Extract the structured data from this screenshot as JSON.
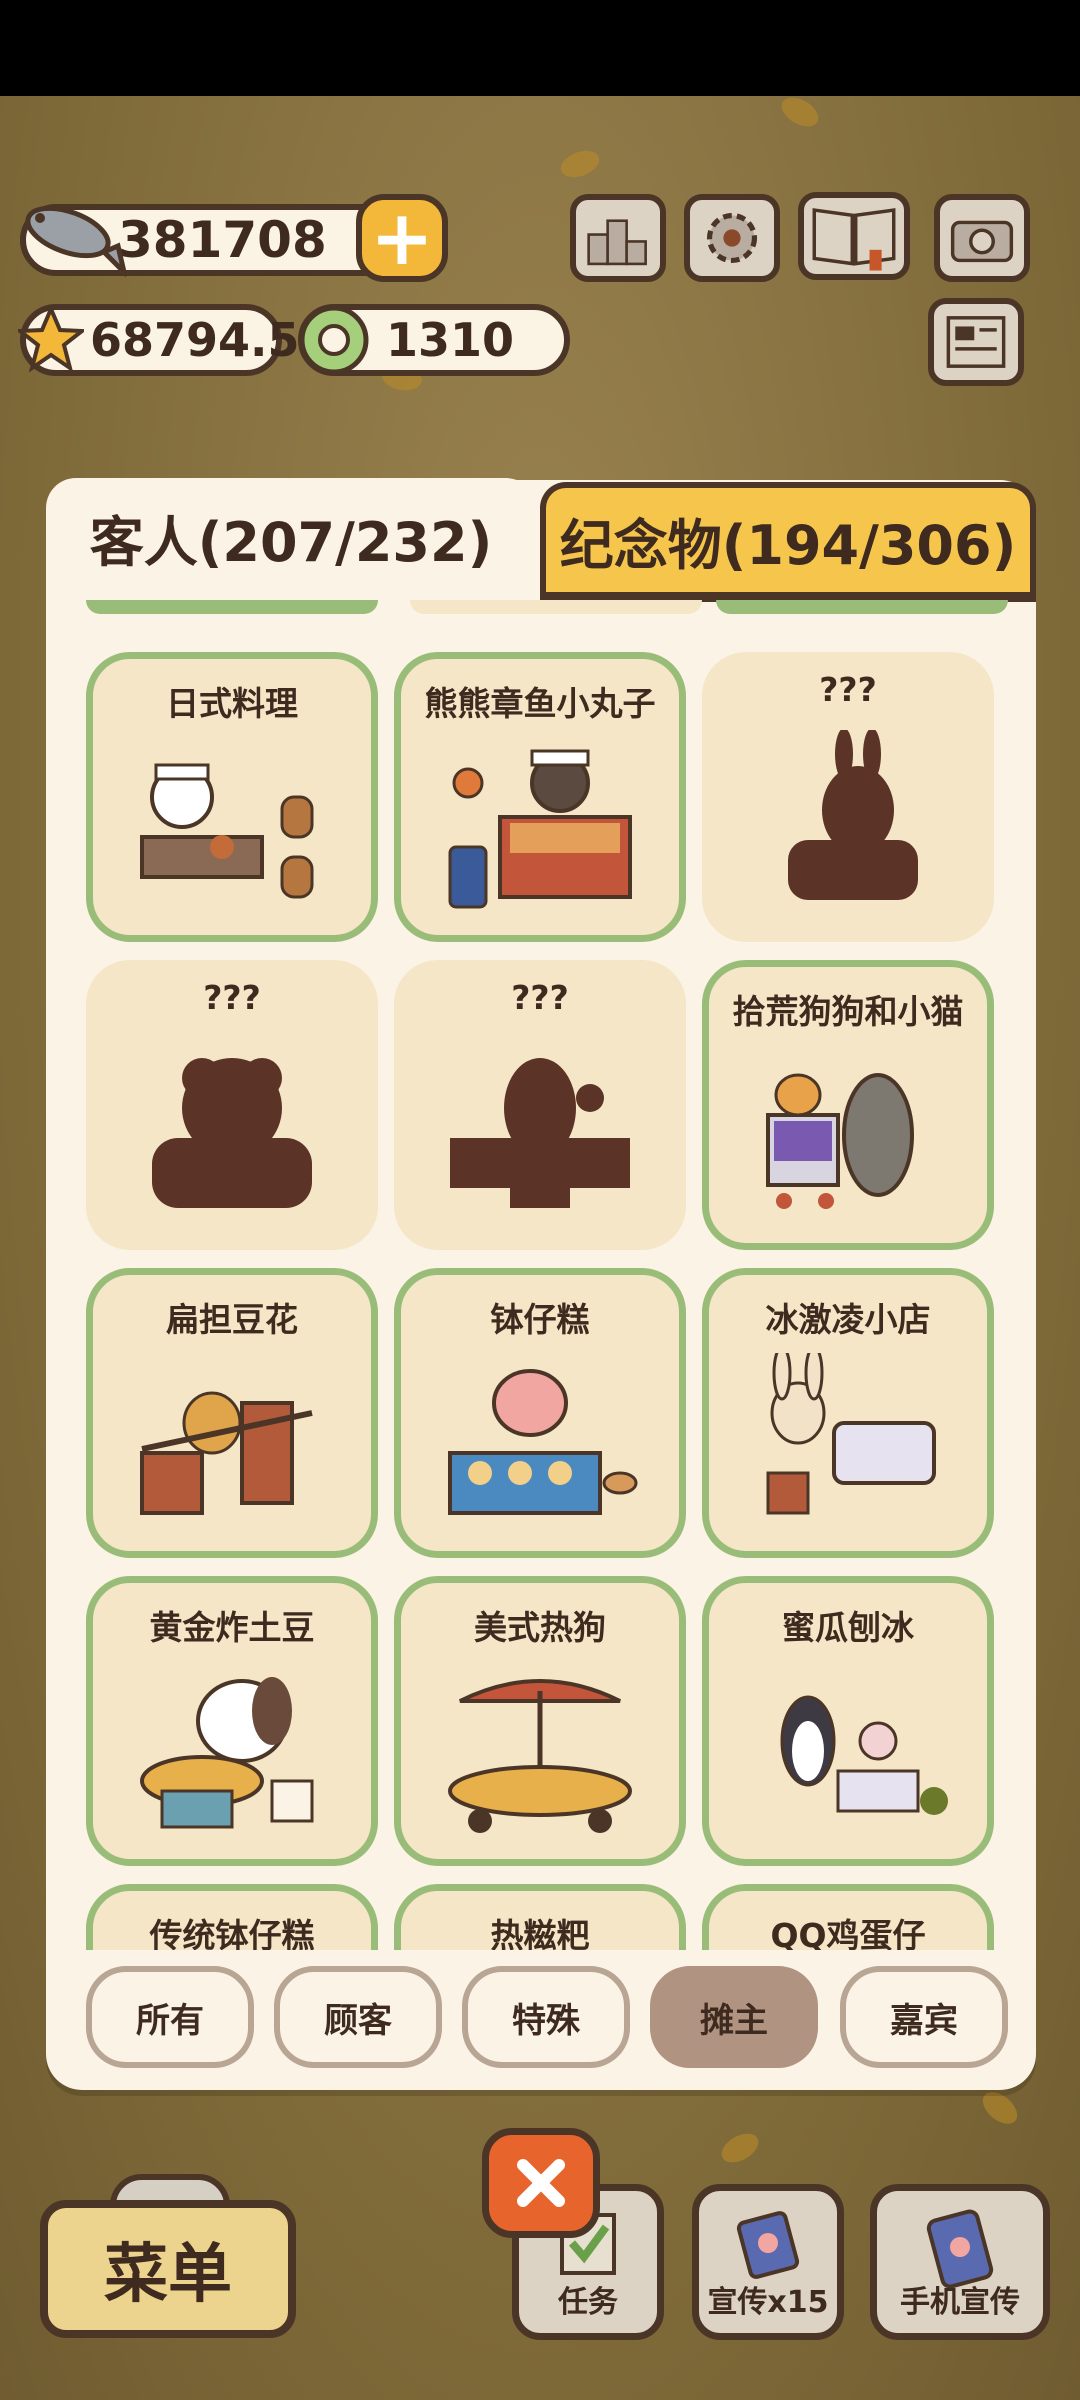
{
  "hud": {
    "fish_count": "381708",
    "star_count": "68794.5",
    "coin_count": "1310"
  },
  "tabs": {
    "guests": "客人(207/232)",
    "souvenirs": "纪念物(194/306)"
  },
  "cards": [
    {
      "title": "日式料理",
      "found": true
    },
    {
      "title": "熊熊章鱼小丸子",
      "found": true
    },
    {
      "title": "???",
      "found": false
    },
    {
      "title": "???",
      "found": false
    },
    {
      "title": "???",
      "found": false
    },
    {
      "title": "拾荒狗狗和小猫",
      "found": true
    },
    {
      "title": "扁担豆花",
      "found": true
    },
    {
      "title": "钵仔糕",
      "found": true
    },
    {
      "title": "冰激凌小店",
      "found": true
    },
    {
      "title": "黄金炸土豆",
      "found": true
    },
    {
      "title": "美式热狗",
      "found": true
    },
    {
      "title": "蜜瓜刨冰",
      "found": true
    },
    {
      "title": "传统钵仔糕",
      "found": true
    },
    {
      "title": "热糍粑",
      "found": true
    },
    {
      "title": "QQ鸡蛋仔",
      "found": true
    }
  ],
  "filters": [
    {
      "label": "所有",
      "active": false
    },
    {
      "label": "顾客",
      "active": false
    },
    {
      "label": "特殊",
      "active": false
    },
    {
      "label": "摊主",
      "active": true
    },
    {
      "label": "嘉宾",
      "active": false
    }
  ],
  "bottom": {
    "menu": "菜单",
    "tasks": "任务",
    "promote": "宣传x15",
    "phone_promote": "手机宣传"
  },
  "colors": {
    "accent_yellow": "#f6c64c",
    "card_border": "#99bd79",
    "close_red": "#e7642c",
    "outline": "#4b3527"
  }
}
